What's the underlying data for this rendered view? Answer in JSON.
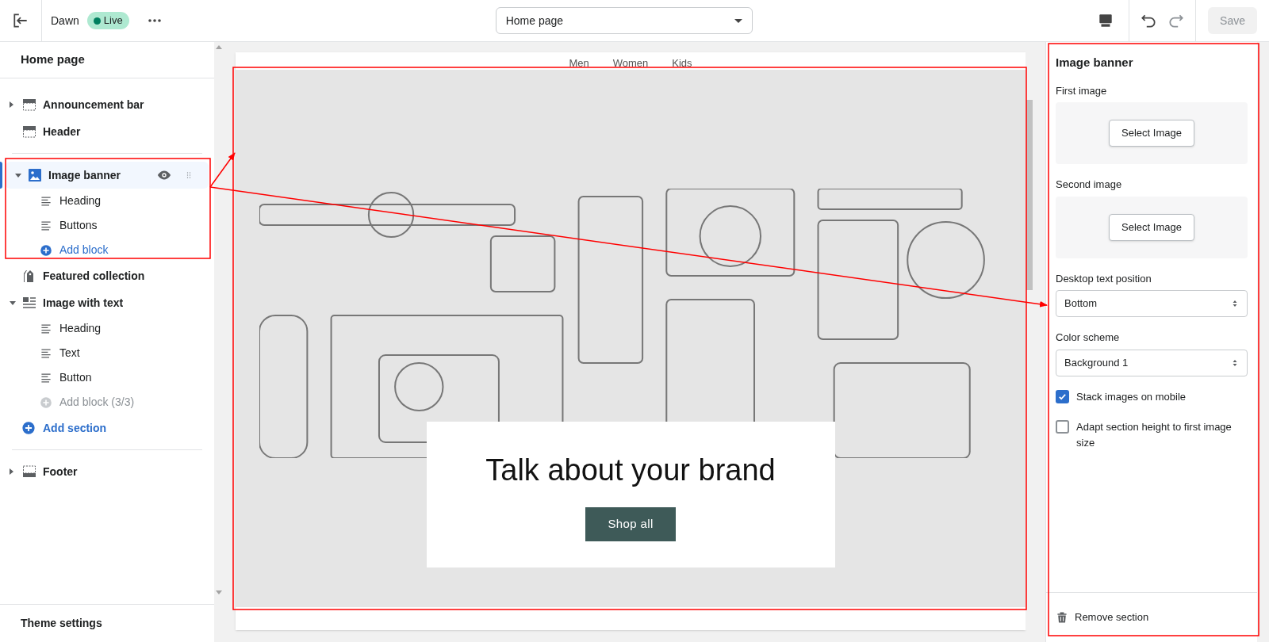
{
  "topbar": {
    "theme": "Dawn",
    "badge": "Live",
    "page_select": "Home page",
    "save": "Save",
    "save_disabled": true
  },
  "sidebar": {
    "title": "Home page",
    "groups": [
      [
        {
          "kind": "bar",
          "label": "Announcement bar",
          "expanded": false,
          "selected": false
        },
        {
          "kind": "header",
          "label": "Header",
          "selected": false
        }
      ],
      [
        {
          "kind": "image",
          "label": "Image banner",
          "expanded": true,
          "selected": true,
          "children": [
            {
              "kind": "block",
              "label": "Heading"
            },
            {
              "kind": "block",
              "label": "Buttons"
            },
            {
              "kind": "add",
              "label": "Add block",
              "disabled": false
            }
          ]
        },
        {
          "kind": "collection",
          "label": "Featured collection",
          "selected": false
        },
        {
          "kind": "image_text",
          "label": "Image with text",
          "expanded": true,
          "selected": false,
          "children": [
            {
              "kind": "block",
              "label": "Heading"
            },
            {
              "kind": "block",
              "label": "Text"
            },
            {
              "kind": "block",
              "label": "Button"
            },
            {
              "kind": "add",
              "label": "Add block (3/3)",
              "disabled": true
            }
          ]
        },
        {
          "kind": "add",
          "label": "Add section"
        }
      ],
      [
        {
          "kind": "footer",
          "label": "Footer",
          "expanded": false,
          "selected": false
        }
      ]
    ],
    "footer": "Theme settings"
  },
  "preview": {
    "nav": [
      "Men",
      "Women",
      "Kids"
    ],
    "heading": "Talk about your brand",
    "button": "Shop all"
  },
  "settings": {
    "title": "Image banner",
    "fields": [
      {
        "kind": "image_picker",
        "label": "First image",
        "button": "Select Image"
      },
      {
        "kind": "image_picker",
        "label": "Second image",
        "button": "Select Image"
      },
      {
        "kind": "select",
        "label": "Desktop text position",
        "value": "Bottom"
      },
      {
        "kind": "select",
        "label": "Color scheme",
        "value": "Background 1"
      },
      {
        "kind": "checkbox",
        "label": "Stack images on mobile",
        "checked": true
      },
      {
        "kind": "checkbox",
        "label": "Adapt section height to first image size",
        "checked": false
      }
    ],
    "remove": "Remove section"
  }
}
